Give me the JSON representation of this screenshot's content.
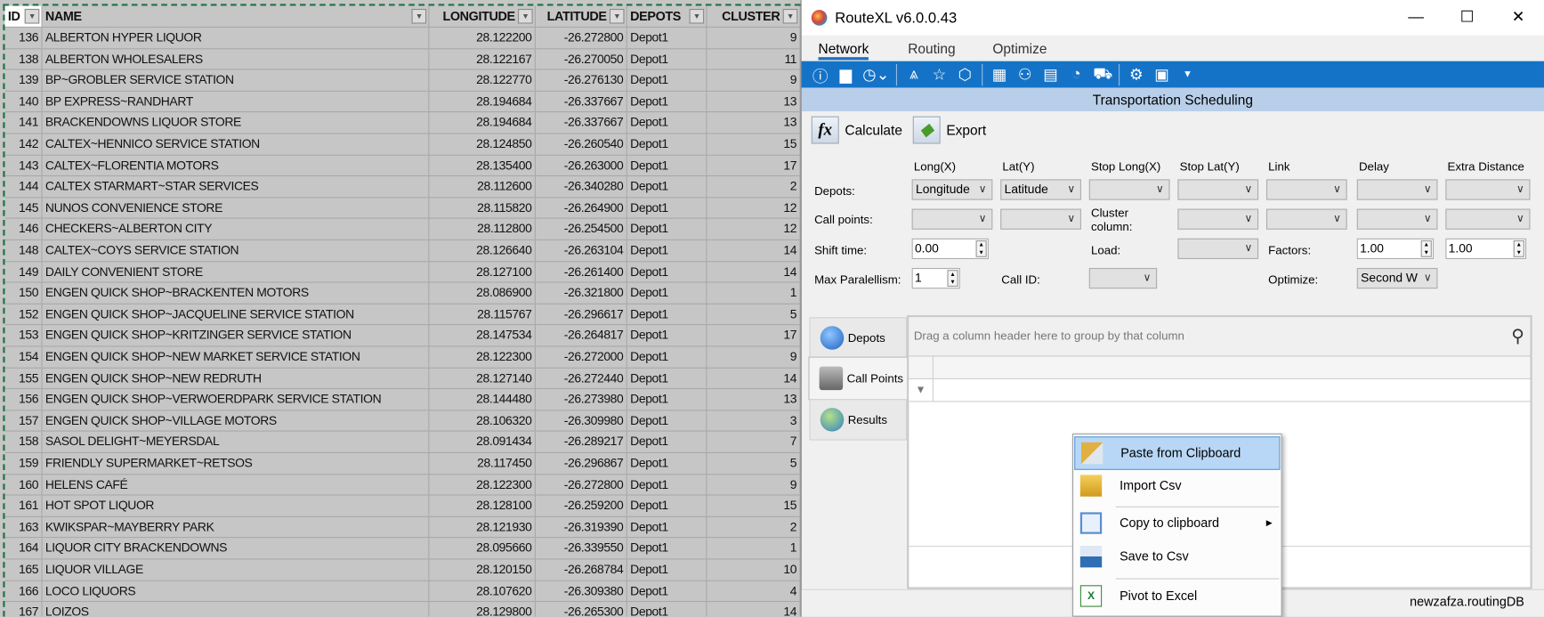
{
  "sheet": {
    "headers": [
      "ID",
      "NAME",
      "LONGITUDE",
      "LATITUDE",
      "DEPOTS",
      "CLUSTER"
    ],
    "rows": [
      [
        "136",
        "ALBERTON HYPER LIQUOR",
        "28.122200",
        "-26.272800",
        "Depot1",
        "9"
      ],
      [
        "138",
        "ALBERTON WHOLESALERS",
        "28.122167",
        "-26.270050",
        "Depot1",
        "11"
      ],
      [
        "139",
        "BP~GROBLER SERVICE STATION",
        "28.122770",
        "-26.276130",
        "Depot1",
        "9"
      ],
      [
        "140",
        "BP EXPRESS~RANDHART",
        "28.194684",
        "-26.337667",
        "Depot1",
        "13"
      ],
      [
        "141",
        "BRACKENDOWNS LIQUOR STORE",
        "28.194684",
        "-26.337667",
        "Depot1",
        "13"
      ],
      [
        "142",
        "CALTEX~HENNICO SERVICE STATION",
        "28.124850",
        "-26.260540",
        "Depot1",
        "15"
      ],
      [
        "143",
        "CALTEX~FLORENTIA MOTORS",
        "28.135400",
        "-26.263000",
        "Depot1",
        "17"
      ],
      [
        "144",
        "CALTEX STARMART~STAR SERVICES",
        "28.112600",
        "-26.340280",
        "Depot1",
        "2"
      ],
      [
        "145",
        "NUNOS CONVENIENCE STORE",
        "28.115820",
        "-26.264900",
        "Depot1",
        "12"
      ],
      [
        "146",
        "CHECKERS~ALBERTON CITY",
        "28.112800",
        "-26.254500",
        "Depot1",
        "12"
      ],
      [
        "148",
        "CALTEX~COYS SERVICE STATION",
        "28.126640",
        "-26.263104",
        "Depot1",
        "14"
      ],
      [
        "149",
        "DAILY CONVENIENT STORE",
        "28.127100",
        "-26.261400",
        "Depot1",
        "14"
      ],
      [
        "150",
        "ENGEN QUICK SHOP~BRACKENTEN MOTORS",
        "28.086900",
        "-26.321800",
        "Depot1",
        "1"
      ],
      [
        "152",
        "ENGEN QUICK SHOP~JACQUELINE SERVICE STATION",
        "28.115767",
        "-26.296617",
        "Depot1",
        "5"
      ],
      [
        "153",
        "ENGEN QUICK SHOP~KRITZINGER SERVICE STATION",
        "28.147534",
        "-26.264817",
        "Depot1",
        "17"
      ],
      [
        "154",
        "ENGEN QUICK SHOP~NEW MARKET SERVICE STATION",
        "28.122300",
        "-26.272000",
        "Depot1",
        "9"
      ],
      [
        "155",
        "ENGEN QUICK SHOP~NEW REDRUTH",
        "28.127140",
        "-26.272440",
        "Depot1",
        "14"
      ],
      [
        "156",
        "ENGEN QUICK SHOP~VERWOERDPARK SERVICE STATION",
        "28.144480",
        "-26.273980",
        "Depot1",
        "13"
      ],
      [
        "157",
        "ENGEN QUICK SHOP~VILLAGE MOTORS",
        "28.106320",
        "-26.309980",
        "Depot1",
        "3"
      ],
      [
        "158",
        "SASOL DELIGHT~MEYERSDAL",
        "28.091434",
        "-26.289217",
        "Depot1",
        "7"
      ],
      [
        "159",
        "FRIENDLY SUPERMARKET~RETSOS",
        "28.117450",
        "-26.296867",
        "Depot1",
        "5"
      ],
      [
        "160",
        "HELENS CAFÉ",
        "28.122300",
        "-26.272800",
        "Depot1",
        "9"
      ],
      [
        "161",
        "HOT SPOT LIQUOR",
        "28.128100",
        "-26.259200",
        "Depot1",
        "15"
      ],
      [
        "163",
        "KWIKSPAR~MAYBERRY PARK",
        "28.121930",
        "-26.319390",
        "Depot1",
        "2"
      ],
      [
        "164",
        "LIQUOR CITY BRACKENDOWNS",
        "28.095660",
        "-26.339550",
        "Depot1",
        "1"
      ],
      [
        "165",
        "LIQUOR VILLAGE",
        "28.120150",
        "-26.268784",
        "Depot1",
        "10"
      ],
      [
        "166",
        "LOCO LIQUORS",
        "28.107620",
        "-26.309380",
        "Depot1",
        "4"
      ],
      [
        "167",
        "LOIZOS",
        "28.129800",
        "-26.265300",
        "Depot1",
        "14"
      ]
    ]
  },
  "window": {
    "title": "RouteXL v6.0.0.43",
    "controls": {
      "minimize": "—",
      "maximize": "☐",
      "close": "✕"
    },
    "tabs": [
      "Network",
      "Routing",
      "Optimize"
    ],
    "active_tab": "Network",
    "toolbar_icons": [
      "info-icon",
      "folder-icon",
      "gauge-icon",
      "road-icon",
      "star-icon",
      "polygon-icon",
      "grid-icon",
      "people-icon",
      "document-icon",
      "clock-truck-icon",
      "truck-icon",
      "settings-icon",
      "save-icon",
      "dropdown-icon"
    ],
    "section_title": "Transportation Scheduling",
    "calculate_label": "Calculate",
    "export_label": "Export",
    "columns": [
      "Long(X)",
      "Lat(Y)",
      "Stop Long(X)",
      "Stop Lat(Y)",
      "Link",
      "Delay",
      "Extra Distance"
    ],
    "labels": {
      "depots": "Depots:",
      "call_points": "Call points:",
      "cluster_column": "Cluster column:",
      "shift_time": "Shift time:",
      "load": "Load:",
      "factors": "Factors:",
      "max_parallelism": "Max Paralellism:",
      "call_id": "Call ID:",
      "optimize": "Optimize:"
    },
    "depots_long": "Longitude",
    "depots_lat": "Latitude",
    "shift_time": "0.00",
    "factor1": "1.00",
    "factor2": "1.00",
    "max_parallelism": "1",
    "optimize_value": "Second W",
    "side_tabs": [
      "Depots",
      "Call Points",
      "Results"
    ],
    "active_side_tab": "Call Points",
    "group_hint": "Drag a column header here to group by that column",
    "status": "newzafza.routingDB",
    "accent": "#1573c7"
  },
  "context_menu": {
    "items": [
      "Paste from Clipboard",
      "Import Csv",
      "Copy to clipboard",
      "Save to Csv",
      "Pivot to Excel"
    ],
    "highlighted": "Paste from Clipboard"
  }
}
